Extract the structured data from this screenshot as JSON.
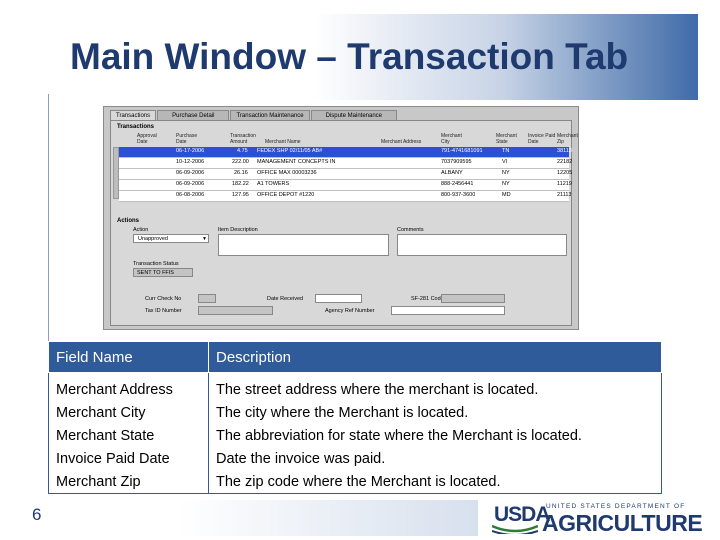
{
  "slide": {
    "title": "Main Window – Transaction Tab",
    "number": "6"
  },
  "screenshot": {
    "tabs": [
      "Transactions",
      "Purchase Detail",
      "Transaction Maintenance",
      "Dispute Maintenance"
    ],
    "transactions_label": "Transactions",
    "columns": [
      {
        "line1": "Approval",
        "line2": "Date"
      },
      {
        "line1": "Purchase",
        "line2": "Date"
      },
      {
        "line1": "Transaction",
        "line2": "Amount"
      },
      {
        "line1": "",
        "line2": "Merchant Name"
      },
      {
        "line1": "",
        "line2": "Merchant Address"
      },
      {
        "line1": "Merchant",
        "line2": "City"
      },
      {
        "line1": "Merchant",
        "line2": "State"
      },
      {
        "line1": "Invoice Paid",
        "line2": "Date"
      },
      {
        "line1": "Merchant",
        "line2": "Zip"
      }
    ],
    "rows": [
      {
        "purchase_date": "06-17-2006",
        "amount": "4.75",
        "merchant_name": "FEDEX SHP 02/11/05 AB#",
        "city": "791-4741681091",
        "state": "TN",
        "zip": "38113",
        "selected": true
      },
      {
        "purchase_date": "10-12-2006",
        "amount": "222.00",
        "merchant_name": "MANAGEMENT CONCEPTS IN",
        "city": "7037909595",
        "state": "VI",
        "zip": "22182",
        "selected": false
      },
      {
        "purchase_date": "06-09-2006",
        "amount": "26.16",
        "merchant_name": "OFFICE MAX    00003236",
        "city": "ALBANY",
        "state": "NY",
        "zip": "12205",
        "selected": false
      },
      {
        "purchase_date": "06-09-2006",
        "amount": "182.22",
        "merchant_name": "A1 TOWERS",
        "city": "888-2456441",
        "state": "NY",
        "zip": "11219",
        "selected": false
      },
      {
        "purchase_date": "06-08-2006",
        "amount": "127.95",
        "merchant_name": "OFFICE DEPOT  #1220",
        "city": "800-937-3600",
        "state": "MD",
        "zip": "21113",
        "selected": false
      }
    ],
    "actions_label": "Actions",
    "action_label": "Action",
    "action_value": "Unapproved",
    "item_description_label": "Item Description",
    "comments_label": "Comments",
    "transaction_status_label": "Transaction Status",
    "transaction_status_value": "SENT TO FFIS",
    "curr_check_no_label": "Curr Check No",
    "date_received_label": "Date Received",
    "sf281_code_label": "SF-281 Code",
    "tax_id_label": "Tax ID Number",
    "agency_ref_label": "Agency Ref Number"
  },
  "table": {
    "headers": [
      "Field Name",
      "Description"
    ],
    "rows": [
      {
        "field": "Merchant Address",
        "desc": "The street address where the merchant is located."
      },
      {
        "field": "Merchant City",
        "desc": "The city where the Merchant is located."
      },
      {
        "field": "Merchant State",
        "desc": "The abbreviation for state where the Merchant is located."
      },
      {
        "field": "Invoice Paid Date",
        "desc": "Date the invoice was paid."
      },
      {
        "field": "Merchant Zip",
        "desc": "The zip code where the Merchant is located."
      }
    ]
  },
  "logo": {
    "usda": "USDA",
    "department": "UNITED STATES DEPARTMENT OF",
    "agriculture": "AGRICULTURE"
  },
  "colors": {
    "title": "#1f3a6e",
    "table_header": "#2f5b9a",
    "selected_row": "#2b4fd6"
  }
}
